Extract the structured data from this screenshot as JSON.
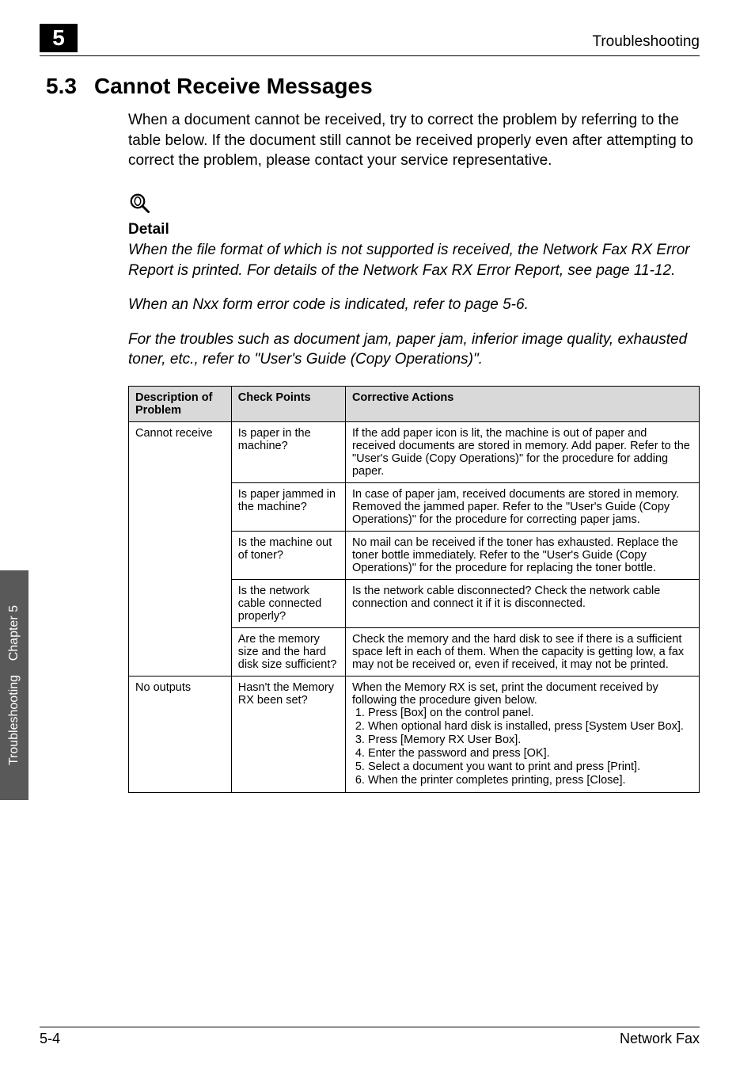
{
  "header": {
    "chapter_badge": "5",
    "running_title": "Troubleshooting"
  },
  "section": {
    "number": "5.3",
    "title": "Cannot Receive Messages"
  },
  "intro": "When a document cannot be received, try to correct the problem by referring to the table below. If the document still cannot be received properly even after attempting to correct the problem, please contact your service representative.",
  "detail": {
    "label": "Detail",
    "para1": "When the file format of which is not supported is received, the Network Fax RX Error Report is printed. For details of the Network Fax RX Error Report, see page 11-12.",
    "para2": "When an Nxx form error code is indicated, refer to page 5-6.",
    "para3": "For the troubles such as document jam, paper jam, inferior image quality, exhausted toner, etc., refer to \"User's Guide (Copy Operations)\"."
  },
  "table": {
    "headers": {
      "c1": "Description of Problem",
      "c2": "Check Points",
      "c3": "Corrective Actions"
    },
    "rows": [
      {
        "problem": "Cannot receive",
        "check": "Is paper in the machine?",
        "action": "If the add paper icon is lit, the machine is out of paper and received documents are stored in memory. Add paper. Refer to the \"User's Guide (Copy Operations)\" for the procedure for adding paper."
      },
      {
        "problem": "",
        "check": "Is paper jammed in the machine?",
        "action": "In case of paper jam, received documents are stored in memory. Removed the jammed paper. Refer to the \"User's Guide (Copy Operations)\" for the procedure for correcting paper jams."
      },
      {
        "problem": "",
        "check": "Is the machine out of toner?",
        "action": "No mail can be received if the toner has exhausted. Replace the toner bottle immediately. Refer to the \"User's Guide (Copy Operations)\" for the procedure for replacing the toner bottle."
      },
      {
        "problem": "",
        "check": "Is the network cable connected properly?",
        "action": "Is the network cable disconnected? Check the network cable connection and connect it if it is disconnected."
      },
      {
        "problem": "",
        "check": "Are the memory size and the hard disk size sufficient?",
        "action": "Check the memory and the hard disk to see if there is a sufficient space left in each of them.\nWhen the capacity is getting low, a fax may not be received or, even if received, it may not be printed."
      },
      {
        "problem": "No outputs",
        "check": "Hasn't the Memory RX been set?",
        "action_intro": "When the Memory RX is set, print the document received by following the procedure given below.",
        "action_list": [
          "Press [Box] on the control panel.",
          "When optional hard disk is installed, press [System User Box].",
          "Press [Memory RX User Box].",
          "Enter the password and press [OK].",
          "Select a document you want to print and press [Print].",
          "When the printer completes printing, press [Close]."
        ]
      }
    ]
  },
  "side_tab": {
    "line1": "Troubleshooting",
    "line2": "Chapter 5"
  },
  "footer": {
    "left": "5-4",
    "right": "Network Fax"
  }
}
